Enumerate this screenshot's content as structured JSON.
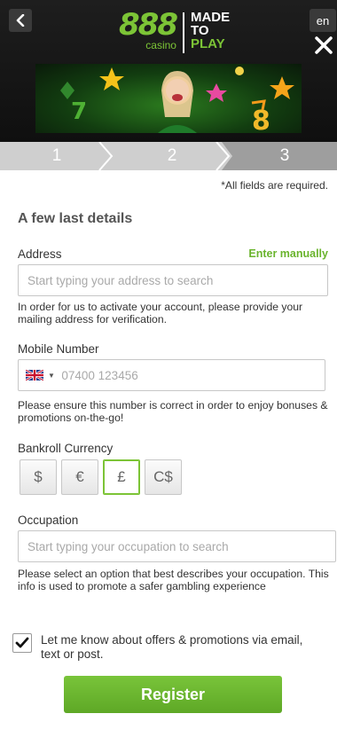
{
  "header": {
    "lang_label": "en",
    "logo": {
      "number": "888",
      "casino": "casino",
      "made": "MADE",
      "to": "TO",
      "play": "PLAY"
    }
  },
  "steps": [
    "1",
    "2",
    "3"
  ],
  "form": {
    "required_note": "*All fields are required.",
    "section_title": "A few last details",
    "address": {
      "label": "Address",
      "enter_manually": "Enter manually",
      "placeholder": "Start typing your address to search",
      "help": "In order for us to activate your account, please provide your mailing address for verification."
    },
    "mobile": {
      "label": "Mobile Number",
      "placeholder": "07400 123456",
      "country_flag": "uk-flag",
      "help": "Please ensure this number is correct in order to enjoy bonuses & promotions on-the-go!"
    },
    "currency": {
      "label": "Bankroll Currency",
      "options": [
        "$",
        "€",
        "£",
        "C$"
      ],
      "selected": "£"
    },
    "occupation": {
      "label": "Occupation",
      "placeholder": "Start typing your occupation to search",
      "help": "Please select an option that best describes your occupation. This info is used to promote a safer gambling experience"
    },
    "offers": {
      "checked": true,
      "label": "Let me know about offers & promotions via email, text or post."
    },
    "register_label": "Register"
  },
  "colors": {
    "accent": "#7cc436",
    "header_bg": "#161616",
    "steps_bg": "#cfcfcf"
  },
  "icons": [
    "back-arrow-icon",
    "close-icon",
    "uk-flag-icon",
    "caret-down-icon",
    "checkmark-icon"
  ]
}
